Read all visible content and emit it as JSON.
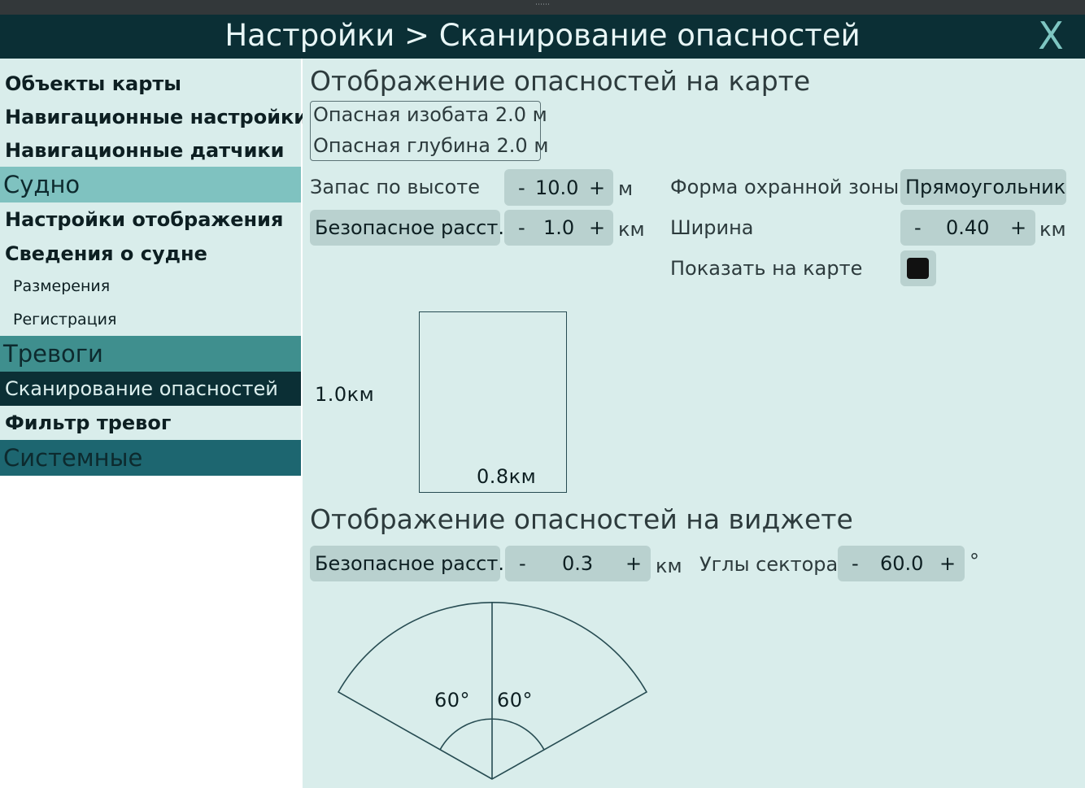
{
  "window": {
    "title": "Настройки > Сканирование опасностей",
    "close_label": "X"
  },
  "sidebar": {
    "items": [
      {
        "label": "Объекты карты",
        "type": "item"
      },
      {
        "label": "Навигационные настройки",
        "type": "item"
      },
      {
        "label": "Навигационные датчики",
        "type": "item"
      },
      {
        "label": "Судно",
        "type": "category"
      },
      {
        "label": "Настройки отображения",
        "type": "item"
      },
      {
        "label": "Сведения о судне",
        "type": "item"
      },
      {
        "label": "Размерения",
        "type": "subitem"
      },
      {
        "label": "Регистрация",
        "type": "subitem"
      },
      {
        "label": "Тревоги",
        "type": "category"
      },
      {
        "label": "Сканирование опасностей",
        "type": "item",
        "selected": true
      },
      {
        "label": "Фильтр тревог",
        "type": "item"
      },
      {
        "label": "Системные",
        "type": "category"
      }
    ]
  },
  "map_section": {
    "title": "Отображение опасностей на карте",
    "info": {
      "isobath": "Опасная изобата 2.0 м",
      "depth": "Опасная глубина 2.0 м"
    },
    "height_margin": {
      "label": "Запас по высоте",
      "minus": "-",
      "value": "10.0",
      "plus": "+",
      "unit": "м"
    },
    "safe_distance": {
      "label": "Безопасное расст.",
      "minus": "-",
      "value": "1.0",
      "plus": "+",
      "unit": "км"
    },
    "zone_shape": {
      "label": "Форма охранной зоны",
      "value": "Прямоугольник"
    },
    "width": {
      "label": "Ширина",
      "minus": "-",
      "value": "0.40",
      "plus": "+",
      "unit": "км"
    },
    "show_on_map": {
      "label": "Показать на карте",
      "checked": true
    },
    "preview": {
      "length_label": "1.0км",
      "width_label": "0.8км"
    }
  },
  "widget_section": {
    "title": "Отображение опасностей на виджете",
    "safe_distance": {
      "label": "Безопасное расст.",
      "minus": "-",
      "value": "0.3",
      "plus": "+",
      "unit": "км"
    },
    "sector_angles": {
      "label": "Углы сектора",
      "minus": "-",
      "value": "60.0",
      "plus": "+",
      "unit": "°"
    },
    "preview": {
      "left_angle": "60°",
      "right_angle": "60°"
    }
  },
  "colors": {
    "titlebar": "#0b2f35",
    "panel_bg": "#d9edeb",
    "category_vessel": "#7fc2c0",
    "category_alarms": "#3f8f8e",
    "category_system": "#1d6670",
    "selected": "#0b2f35",
    "button": "#b9d1cf"
  }
}
